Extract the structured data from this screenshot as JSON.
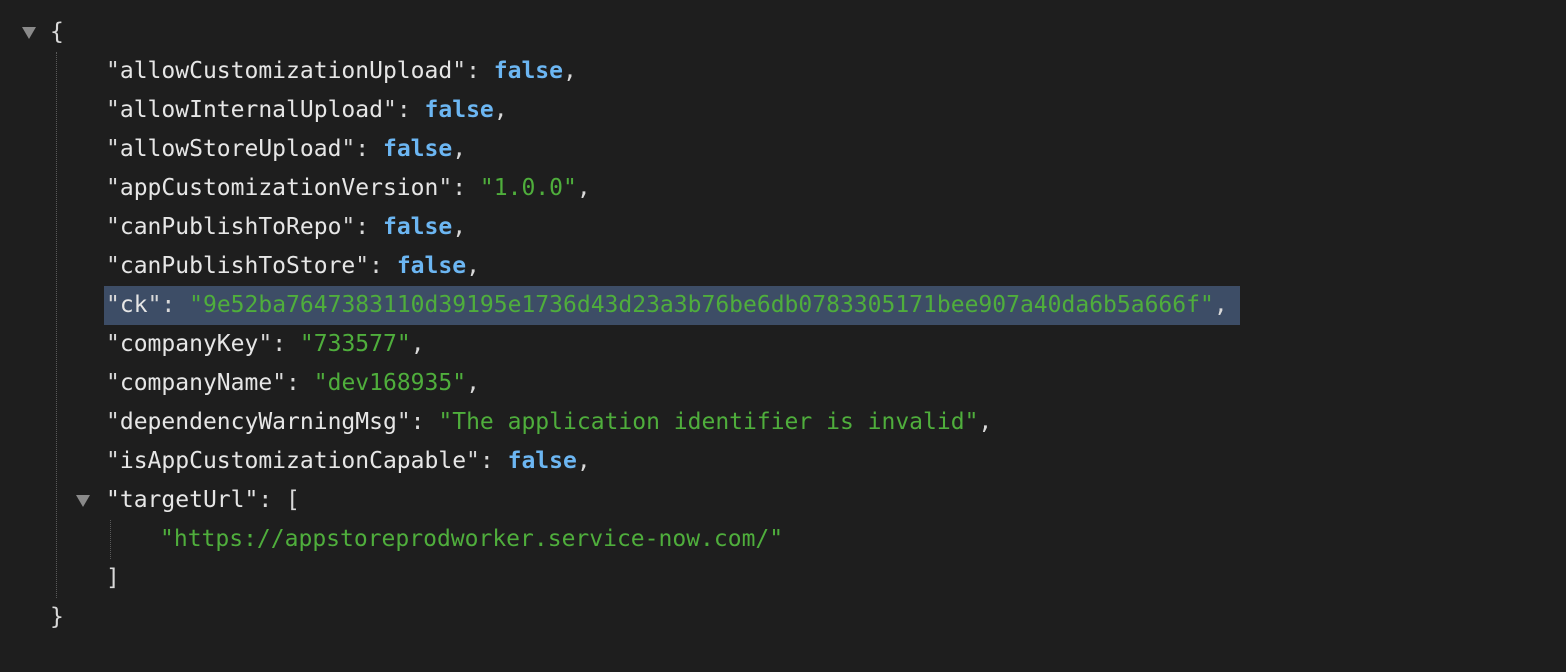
{
  "json": {
    "open_brace": "{",
    "close_brace": "}",
    "entries": [
      {
        "key": "allowCustomizationUpload",
        "value": "false",
        "type": "boolean"
      },
      {
        "key": "allowInternalUpload",
        "value": "false",
        "type": "boolean"
      },
      {
        "key": "allowStoreUpload",
        "value": "false",
        "type": "boolean"
      },
      {
        "key": "appCustomizationVersion",
        "value": "\"1.0.0\"",
        "type": "string"
      },
      {
        "key": "canPublishToRepo",
        "value": "false",
        "type": "boolean"
      },
      {
        "key": "canPublishToStore",
        "value": "false",
        "type": "boolean"
      },
      {
        "key": "ck",
        "value": "\"9e52ba7647383110d39195e1736d43d23a3b76be6db0783305171bee907a40da6b5a666f\"",
        "type": "string",
        "selected": true
      },
      {
        "key": "companyKey",
        "value": "\"733577\"",
        "type": "string"
      },
      {
        "key": "companyName",
        "value": "\"dev168935\"",
        "type": "string"
      },
      {
        "key": "dependencyWarningMsg",
        "value": "\"The application identifier is invalid\"",
        "type": "string"
      },
      {
        "key": "isAppCustomizationCapable",
        "value": "false",
        "type": "boolean"
      }
    ],
    "array_entry": {
      "key": "targetUrl",
      "open_bracket": "[",
      "close_bracket": "]",
      "items": [
        "\"https://appstoreprodworker.service-now.com/\""
      ]
    }
  },
  "colors": {
    "background": "#1e1e1e",
    "key": "#e6e6e6",
    "boolean": "#6cb6f2",
    "string": "#4fae3c",
    "selection": "#3d4d66"
  },
  "icons": [
    "collapse-triangle-icon"
  ]
}
